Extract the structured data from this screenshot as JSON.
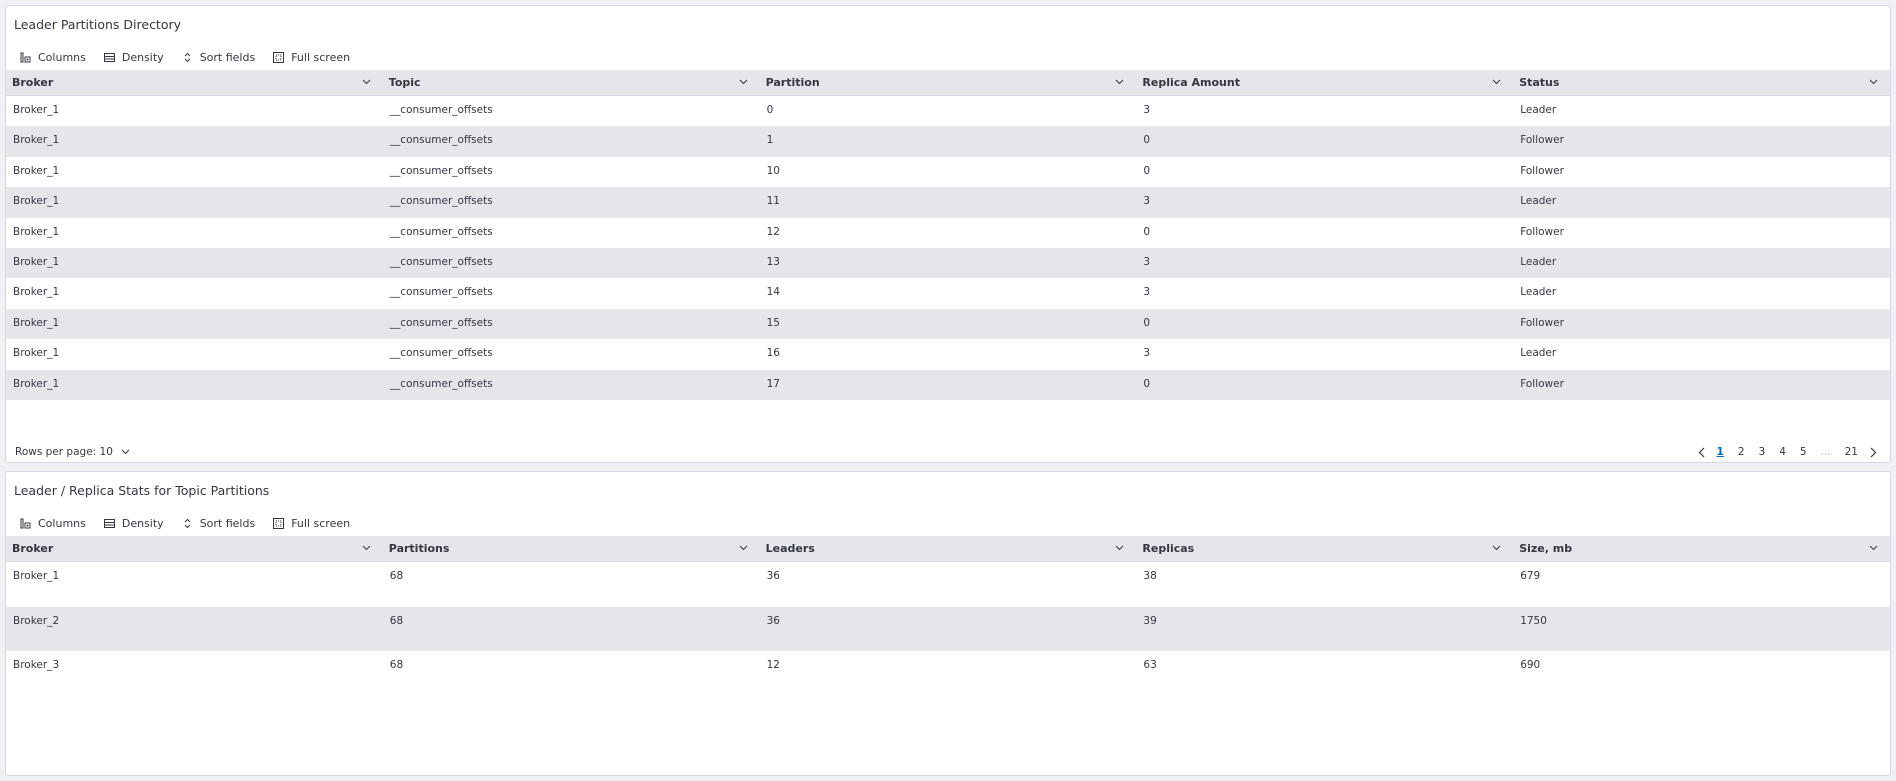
{
  "panel1": {
    "title": "Leader Partitions Directory",
    "toolbar": {
      "columns": "Columns",
      "density": "Density",
      "sort": "Sort fields",
      "fullscreen": "Full screen"
    },
    "columns": [
      "Broker",
      "Topic",
      "Partition",
      "Replica Amount",
      "Status"
    ],
    "rows": [
      [
        "Broker_1",
        "__consumer_offsets",
        "0",
        "3",
        "Leader"
      ],
      [
        "Broker_1",
        "__consumer_offsets",
        "1",
        "0",
        "Follower"
      ],
      [
        "Broker_1",
        "__consumer_offsets",
        "10",
        "0",
        "Follower"
      ],
      [
        "Broker_1",
        "__consumer_offsets",
        "11",
        "3",
        "Leader"
      ],
      [
        "Broker_1",
        "__consumer_offsets",
        "12",
        "0",
        "Follower"
      ],
      [
        "Broker_1",
        "__consumer_offsets",
        "13",
        "3",
        "Leader"
      ],
      [
        "Broker_1",
        "__consumer_offsets",
        "14",
        "3",
        "Leader"
      ],
      [
        "Broker_1",
        "__consumer_offsets",
        "15",
        "0",
        "Follower"
      ],
      [
        "Broker_1",
        "__consumer_offsets",
        "16",
        "3",
        "Leader"
      ],
      [
        "Broker_1",
        "__consumer_offsets",
        "17",
        "0",
        "Follower"
      ]
    ],
    "rows_per_page": "Rows per page: 10",
    "pages": [
      "1",
      "2",
      "3",
      "4",
      "5",
      "...",
      "21"
    ],
    "active_page": "1"
  },
  "panel2": {
    "title": "Leader / Replica Stats for Topic Partitions",
    "toolbar": {
      "columns": "Columns",
      "density": "Density",
      "sort": "Sort fields",
      "fullscreen": "Full screen"
    },
    "columns": [
      "Broker",
      "Partitions",
      "Leaders",
      "Replicas",
      "Size, mb"
    ],
    "rows": [
      [
        "Broker_1",
        "68",
        "36",
        "38",
        "679"
      ],
      [
        "Broker_2",
        "68",
        "36",
        "39",
        "1750"
      ],
      [
        "Broker_3",
        "68",
        "12",
        "63",
        "690"
      ]
    ]
  },
  "colors": {
    "header_bg": "#e4e6ea",
    "active_page": "#006bb4"
  }
}
